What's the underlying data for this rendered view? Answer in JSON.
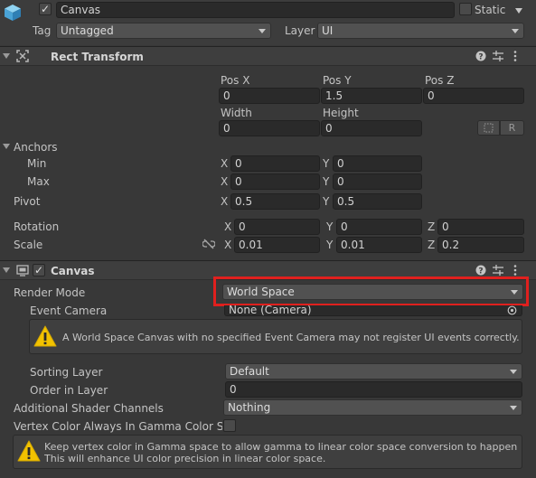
{
  "header": {
    "object_name": "Canvas",
    "active_checked": true,
    "static_label": "Static",
    "static_checked": false,
    "tag_label": "Tag",
    "tag_value": "Untagged",
    "layer_label": "Layer",
    "layer_value": "UI"
  },
  "rect_transform": {
    "title": "Rect Transform",
    "pos_x_label": "Pos X",
    "pos_y_label": "Pos Y",
    "pos_z_label": "Pos Z",
    "pos_x": "0",
    "pos_y": "1.5",
    "pos_z": "0",
    "width_label": "Width",
    "height_label": "Height",
    "width": "0",
    "height": "0",
    "raw_button": "R",
    "anchors_label": "Anchors",
    "min_label": "Min",
    "max_label": "Max",
    "min_x": "0",
    "min_y": "0",
    "max_x": "0",
    "max_y": "0",
    "pivot_label": "Pivot",
    "pivot_x": "0.5",
    "pivot_y": "0.5",
    "rotation_label": "Rotation",
    "rot_x": "0",
    "rot_y": "0",
    "rot_z": "0",
    "scale_label": "Scale",
    "scale_x": "0.01",
    "scale_y": "0.01",
    "scale_z": "0.2",
    "axis_x": "X",
    "axis_y": "Y",
    "axis_z": "Z"
  },
  "canvas": {
    "title": "Canvas",
    "enabled": true,
    "render_mode_label": "Render Mode",
    "render_mode_value": "World Space",
    "event_camera_label": "Event Camera",
    "event_camera_value": "None (Camera)",
    "warning_text": "A World Space Canvas with no specified Event Camera may not register UI events correctly.",
    "sorting_layer_label": "Sorting Layer",
    "sorting_layer_value": "Default",
    "order_in_layer_label": "Order in Layer",
    "order_in_layer_value": "0",
    "shader_channels_label": "Additional Shader Channels",
    "shader_channels_value": "Nothing",
    "vertex_color_label": "Vertex Color Always In Gamma Color Spa",
    "vertex_color_checked": false,
    "info_line1": "Keep vertex color in Gamma space to allow gamma to linear color space conversion to happen in UI shaders.",
    "info_line2": "This will enhance UI color precision in linear color space."
  },
  "colors": {
    "highlight": "#e0201e",
    "warning": "#f2c200",
    "background": "#383838"
  },
  "icons": [
    "cube-icon",
    "rect-transform-icon",
    "canvas-icon",
    "help-icon",
    "preset-icon",
    "kebab-menu-icon",
    "warning-icon",
    "object-picker-icon",
    "blueprint-mode-icon",
    "constrain-proportions-icon"
  ]
}
